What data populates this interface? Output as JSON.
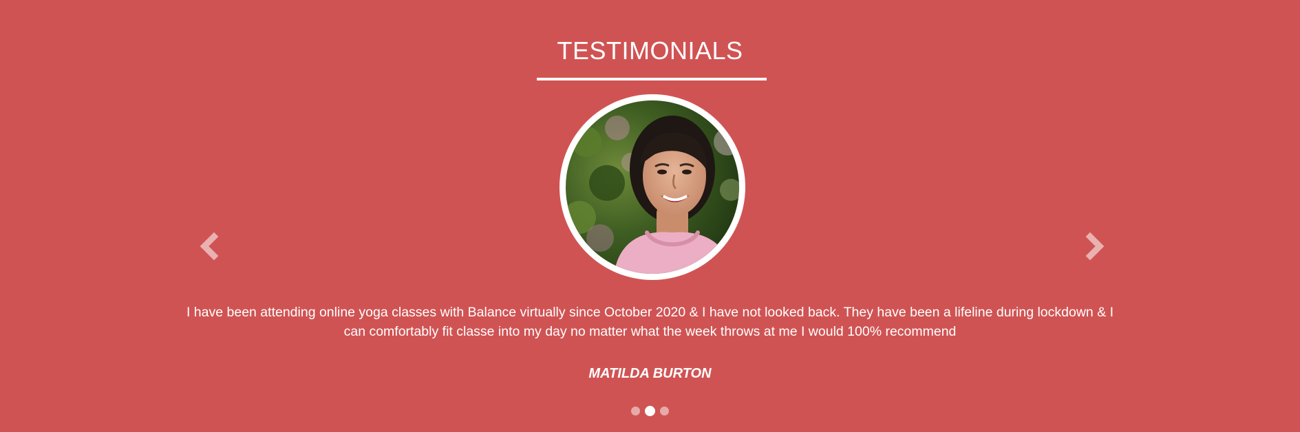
{
  "testimonials": {
    "title": "TESTIMONIALS",
    "quote": "I have been attending online yoga classes with Balance virtually since October 2020 & I have not looked back. They have been a lifeline during lockdown & I can comfortably fit classe into my day no matter what the week throws at me I would 100% recommend",
    "author": "MATILDA BURTON",
    "prev_icon": "chevron-left-icon",
    "next_icon": "chevron-right-icon",
    "slide_count": 3,
    "active_slide": 2
  },
  "colors": {
    "background": "#d05353",
    "text": "#ffffff"
  }
}
